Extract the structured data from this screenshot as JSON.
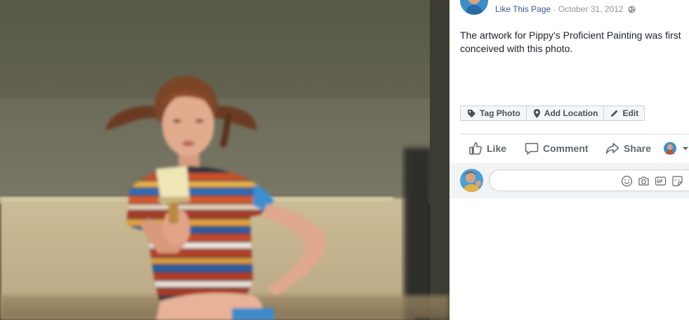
{
  "post": {
    "like_page_label": "Like This Page",
    "separator": " · ",
    "date": "October 31, 2012",
    "caption": "The artwork for Pippy's Proficient Painting was first conceived with this photo."
  },
  "photo_actions": {
    "tag_photo": "Tag Photo",
    "add_location": "Add Location",
    "edit": "Edit"
  },
  "ufi": {
    "like": "Like",
    "comment": "Comment",
    "share": "Share"
  },
  "composer": {
    "placeholder": ""
  },
  "icons": {
    "audience": "globe-icon",
    "tag": "tag-icon",
    "location": "location-pin-icon",
    "edit": "pencil-icon",
    "like": "thumbs-up-icon",
    "comment": "comment-bubble-icon",
    "share": "share-arrow-icon",
    "emoji": "smiley-icon",
    "camera": "camera-icon",
    "gif": "gif-icon",
    "sticker": "sticker-icon"
  },
  "colors": {
    "link": "#385898",
    "muted": "#90949c",
    "button_text": "#4b4f56",
    "ufi_text": "#606770"
  }
}
